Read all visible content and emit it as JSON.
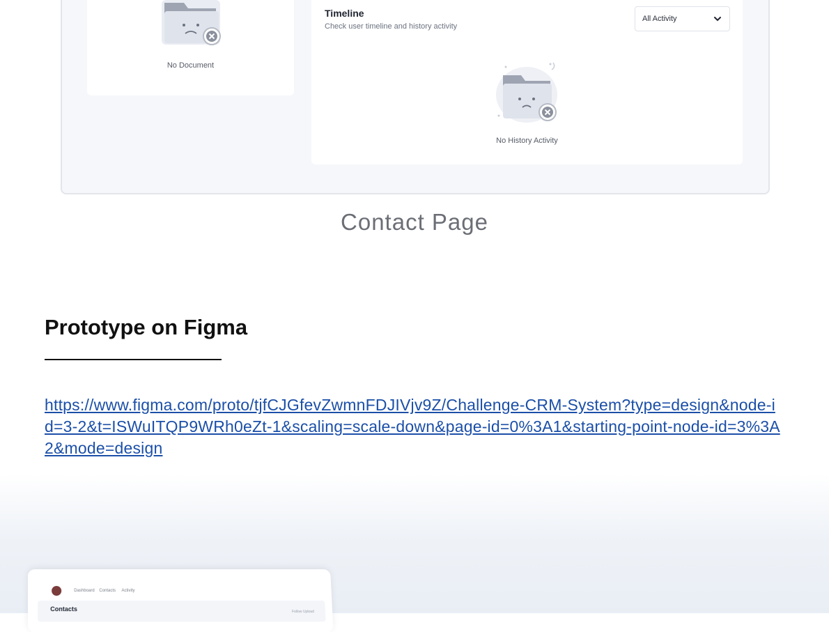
{
  "document_panel": {
    "empty_label": "No Document"
  },
  "timeline": {
    "title": "Timeline",
    "subtitle": "Check user timeline and history activity",
    "filter_value": "All Activity",
    "empty_label": "No History Activity"
  },
  "section_caption": "Contact Page",
  "prototype": {
    "heading": "Prototype on Figma",
    "link_text": "https://www.figma.com/proto/tjfCJGfevZwmnFDJIVjv9Z/Challenge-CRM-System?type=design&node-id=3-2&t=ISWuITQP9WRh0eZt-1&scaling=scale-down&page-id=0%3A1&starting-point-node-id=3%3A2&mode=design"
  },
  "mockup": {
    "nav_items": [
      "Dashboard",
      "Contacts",
      "Activity"
    ],
    "title": "Contacts",
    "right_label": "Follow Upload"
  },
  "icons": {
    "empty_state": "empty-folder-icon",
    "dropdown": "chevron-down-icon",
    "avatar": "avatar"
  },
  "colors": {
    "link": "#1b4fa8",
    "caption": "#6b6e75",
    "card_bg": "#f6f7fb"
  }
}
